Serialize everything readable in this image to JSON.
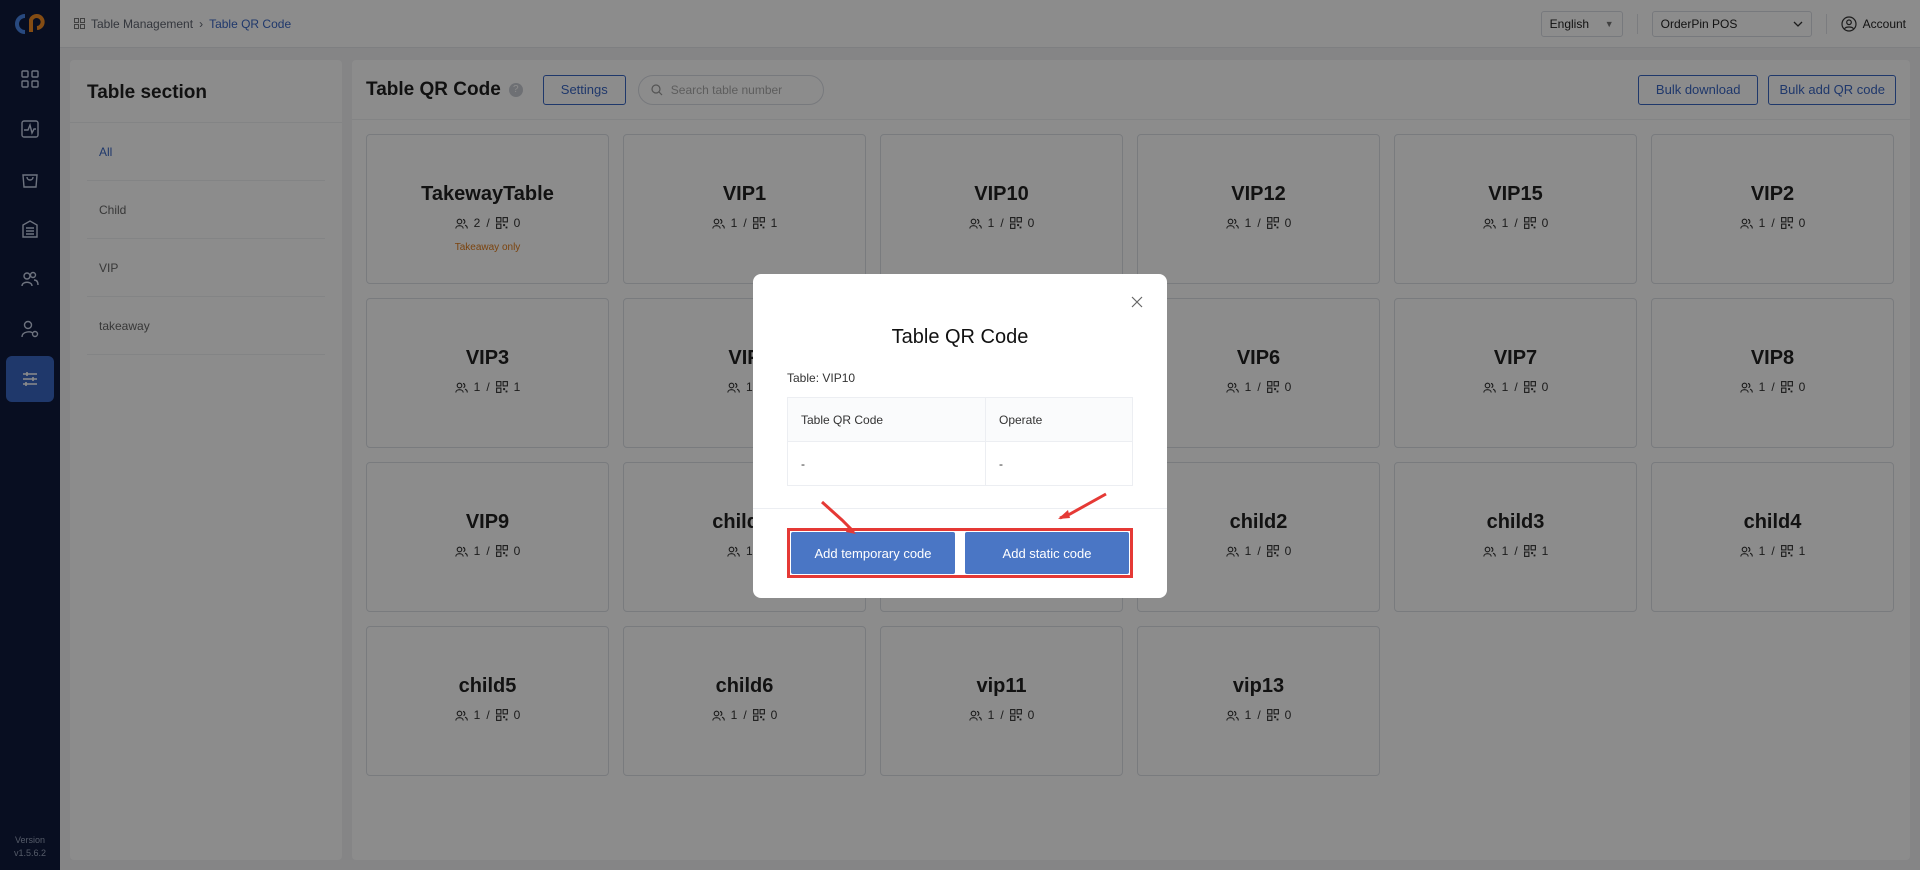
{
  "breadcrumb": {
    "parent": "Table Management",
    "current": "Table QR Code"
  },
  "topbar": {
    "language": "English",
    "store": "OrderPin POS",
    "account": "Account"
  },
  "rail": {
    "items": [
      "dashboard-icon",
      "activity-icon",
      "bag-icon",
      "building-icon",
      "users-icon",
      "user-settings-icon",
      "sliders-icon"
    ],
    "active_index": 6,
    "version_label": "Version",
    "version": "v1.5.6.2"
  },
  "sections": {
    "title": "Table section",
    "items": [
      {
        "label": "All",
        "active": true
      },
      {
        "label": "Child",
        "active": false
      },
      {
        "label": "VIP",
        "active": false
      },
      {
        "label": "takeaway",
        "active": false
      }
    ]
  },
  "main": {
    "title": "Table QR Code",
    "help": "?",
    "settings_label": "Settings",
    "search_placeholder": "Search table number",
    "bulk_download_label": "Bulk download",
    "bulk_add_label": "Bulk add QR code"
  },
  "tables": [
    {
      "name": "TakewayTable",
      "seats": "2",
      "codes": "0",
      "note": "Takeaway only"
    },
    {
      "name": "VIP1",
      "seats": "1",
      "codes": "1"
    },
    {
      "name": "VIP10",
      "seats": "1",
      "codes": "0"
    },
    {
      "name": "VIP12",
      "seats": "1",
      "codes": "0"
    },
    {
      "name": "VIP15",
      "seats": "1",
      "codes": "0"
    },
    {
      "name": "VIP2",
      "seats": "1",
      "codes": "0"
    },
    {
      "name": "VIP3",
      "seats": "1",
      "codes": "1"
    },
    {
      "name": "VIP",
      "seats": "1",
      "codes": ""
    },
    {
      "name": "",
      "seats": "",
      "codes": ""
    },
    {
      "name": "VIP6",
      "seats": "1",
      "codes": "0"
    },
    {
      "name": "VIP7",
      "seats": "1",
      "codes": "0"
    },
    {
      "name": "VIP8",
      "seats": "1",
      "codes": "0"
    },
    {
      "name": "VIP9",
      "seats": "1",
      "codes": "0"
    },
    {
      "name": "child p",
      "seats": "1",
      "codes": ""
    },
    {
      "name": "",
      "seats": "",
      "codes": ""
    },
    {
      "name": "child2",
      "seats": "1",
      "codes": "0"
    },
    {
      "name": "child3",
      "seats": "1",
      "codes": "1"
    },
    {
      "name": "child4",
      "seats": "1",
      "codes": "1"
    },
    {
      "name": "child5",
      "seats": "1",
      "codes": "0"
    },
    {
      "name": "child6",
      "seats": "1",
      "codes": "0"
    },
    {
      "name": "vip11",
      "seats": "1",
      "codes": "0"
    },
    {
      "name": "vip13",
      "seats": "1",
      "codes": "0"
    }
  ],
  "modal": {
    "title": "Table QR Code",
    "table_line": "Table: VIP10",
    "columns": [
      "Table QR Code",
      "Operate"
    ],
    "row": [
      "-",
      "-"
    ],
    "temp_button": "Add temporary code",
    "static_button": "Add static code"
  },
  "colors": {
    "accent": "#3a66c4",
    "highlight": "#e53935",
    "rail": "#0f1b3d"
  }
}
